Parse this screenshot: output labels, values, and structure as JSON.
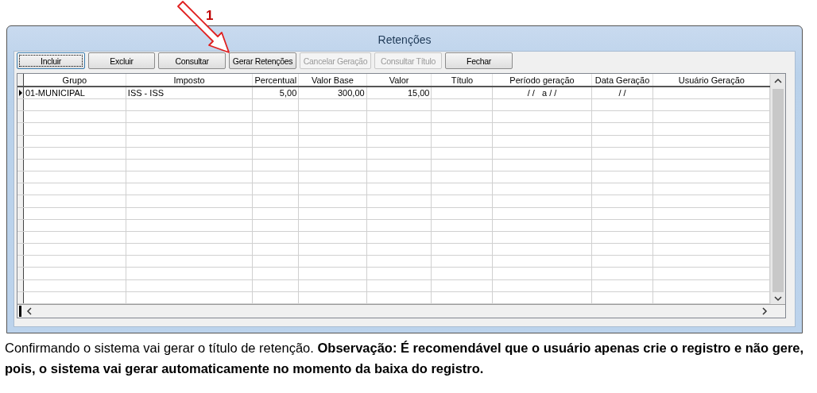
{
  "annotation": {
    "label": "1"
  },
  "window": {
    "title": "Retenções"
  },
  "buttons": [
    {
      "label": "Incluir",
      "disabled": false,
      "focused": true
    },
    {
      "label": "Excluir",
      "disabled": false,
      "focused": false
    },
    {
      "label": "Consultar",
      "disabled": false,
      "focused": false
    },
    {
      "label": "Gerar Retenções",
      "disabled": false,
      "focused": false
    },
    {
      "label": "Cancelar Geração",
      "disabled": true,
      "focused": false
    },
    {
      "label": "Consultar Título",
      "disabled": true,
      "focused": false
    },
    {
      "label": "Fechar",
      "disabled": false,
      "focused": false
    }
  ],
  "table": {
    "columns": [
      {
        "label": "Grupo"
      },
      {
        "label": "Imposto"
      },
      {
        "label": "Percentual"
      },
      {
        "label": "Valor Base"
      },
      {
        "label": "Valor"
      },
      {
        "label": "Título"
      },
      {
        "label": "Período geração"
      },
      {
        "label": "Data Geração"
      },
      {
        "label": "Usuário Geração"
      }
    ],
    "rows": [
      {
        "selected": true,
        "cells": [
          "01-MUNICIPAL",
          "ISS - ISS",
          "5,00",
          "300,00",
          "15,00",
          "",
          "/ /   a / /",
          "/ /",
          ""
        ]
      }
    ]
  },
  "caption": "Confirmando o sistema vai gerar o título de retenção. **Observação: É recomendável que o usuário apenas crie o registro e não gere, pois, o sistema vai gerar automaticamente no momento da baixa do registro.**"
}
